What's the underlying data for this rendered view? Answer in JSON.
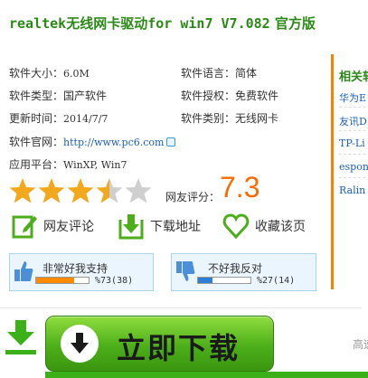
{
  "title": {
    "latin": "realtek",
    "rest_cn": "无线网卡驱动",
    "latin2": "for win7 V7.082",
    "suffix": " 官方版"
  },
  "info": {
    "size_label": "软件大小：",
    "size_value": "6.0M",
    "lang_label": "软件语言：",
    "lang_value": "简体",
    "type_label": "软件类型：",
    "type_value": "国产软件",
    "license_label": "软件授权：",
    "license_value": "免费软件",
    "update_label": "更新时间：",
    "update_value": "2014/7/7",
    "category_label": "软件类别：",
    "category_value": "无线网卡",
    "site_label": "软件官网：",
    "site_value": "http://www.pc6.com",
    "platform_label": "应用平台：",
    "platform_value": "WinXP, Win7"
  },
  "rating": {
    "stars": 3.5,
    "max": 5,
    "label": "网友评分：",
    "score": "7.3"
  },
  "actions": {
    "review": "网友评论",
    "download_addr": "下载地址",
    "favorite": "收藏该页"
  },
  "votes": {
    "good_label": "非常好我支持",
    "good_pct": "%73(38)",
    "good_fraction": 0.73,
    "bad_label": "不好我反对",
    "bad_pct": "%27(14)",
    "bad_fraction": 0.27
  },
  "download": {
    "button": "立即下载",
    "aside": "高速"
  },
  "sidebar": {
    "title": "相关软件",
    "items": [
      "华为E",
      "友讯D",
      "TP-Li",
      "espon",
      "Ralin"
    ]
  },
  "colors": {
    "accent_green": "#2b8a17",
    "star_gold": "#f2a81d",
    "score_orange": "#ff6a00",
    "bar_good": "#ff8a00",
    "bar_bad": "#2a7fd4"
  }
}
